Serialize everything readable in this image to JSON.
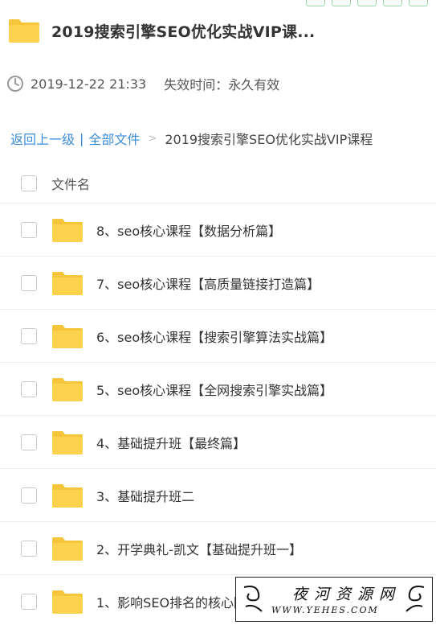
{
  "header": {
    "title": "2019搜索引擎SEO优化实战VIP课..."
  },
  "meta": {
    "date": "2019-12-22 21:33",
    "expiry": "失效时间：永久有效"
  },
  "breadcrumb": {
    "back": "返回上一级",
    "sep": "|",
    "all_files": "全部文件",
    "gt": ">",
    "current": "2019搜索引擎SEO优化实战VIP课程"
  },
  "list": {
    "header_label": "文件名",
    "items": [
      {
        "name": "8、seo核心课程【数据分析篇】"
      },
      {
        "name": "7、seo核心课程【高质量链接打造篇】"
      },
      {
        "name": "6、seo核心课程【搜索引擎算法实战篇】"
      },
      {
        "name": "5、seo核心课程【全网搜索引擎实战篇】"
      },
      {
        "name": "4、基础提升班【最终篇】"
      },
      {
        "name": "3、基础提升班二"
      },
      {
        "name": "2、开学典礼-凯文【基础提升班一】"
      },
      {
        "name": "1、影响SEO排名的核心因素"
      }
    ]
  },
  "watermark": {
    "title": "夜河资源网",
    "url": "WWW.YEHES.COM"
  },
  "colors": {
    "folder": "#fcd24e",
    "link": "#3b8cd9",
    "border": "#ececec"
  },
  "icons": {
    "folder": "folder-icon",
    "clock": "clock-icon",
    "checkbox": "checkbox-icon"
  }
}
